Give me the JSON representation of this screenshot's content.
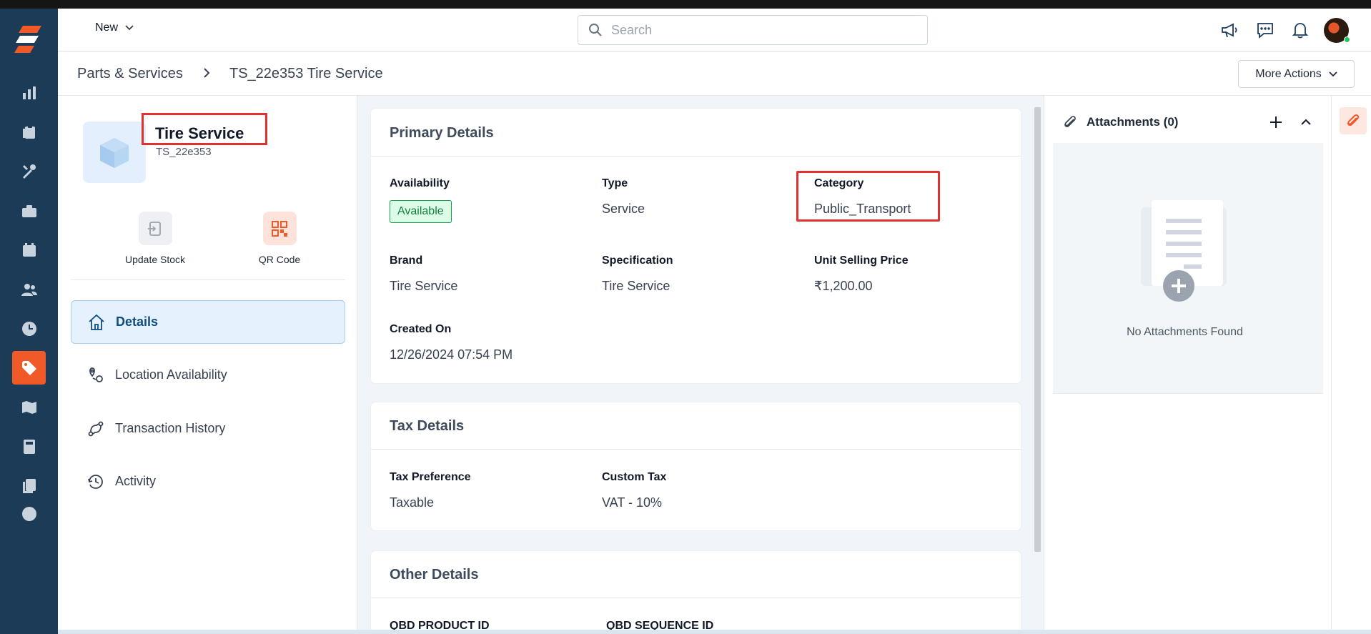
{
  "header": {
    "new_label": "New",
    "search_placeholder": "Search"
  },
  "breadcrumb": {
    "parent": "Parts & Services",
    "current": "TS_22e353 Tire Service"
  },
  "more_actions_label": "More Actions",
  "product": {
    "name": "Tire Service",
    "code": "TS_22e353",
    "actions": [
      "Update Stock",
      "QR Code"
    ]
  },
  "side_menu": [
    {
      "label": "Details",
      "icon": "home-icon",
      "active": true
    },
    {
      "label": "Location Availability",
      "icon": "location-icon",
      "active": false
    },
    {
      "label": "Transaction History",
      "icon": "transaction-icon",
      "active": false
    },
    {
      "label": "Activity",
      "icon": "history-icon",
      "active": false
    }
  ],
  "primary": {
    "title": "Primary Details",
    "availability_label": "Availability",
    "availability_value": "Available",
    "type_label": "Type",
    "type_value": "Service",
    "category_label": "Category",
    "category_value": "Public_Transport",
    "brand_label": "Brand",
    "brand_value": "Tire Service",
    "spec_label": "Specification",
    "spec_value": "Tire Service",
    "price_label": "Unit Selling Price",
    "price_value": "₹1,200.00",
    "created_label": "Created On",
    "created_value": "12/26/2024 07:54 PM"
  },
  "tax": {
    "title": "Tax Details",
    "pref_label": "Tax Preference",
    "pref_value": "Taxable",
    "custom_label": "Custom Tax",
    "custom_value": "VAT - 10%"
  },
  "other": {
    "title": "Other Details",
    "qbd_product_label": "QBD PRODUCT ID",
    "qbd_sequence_label": "QBD SEQUENCE ID"
  },
  "attachments": {
    "title": "Attachments (0)",
    "empty_text": "No Attachments Found"
  },
  "colors": {
    "nav_bg": "#1c3b57",
    "accent": "#f05a28",
    "highlight": "#e03131"
  }
}
